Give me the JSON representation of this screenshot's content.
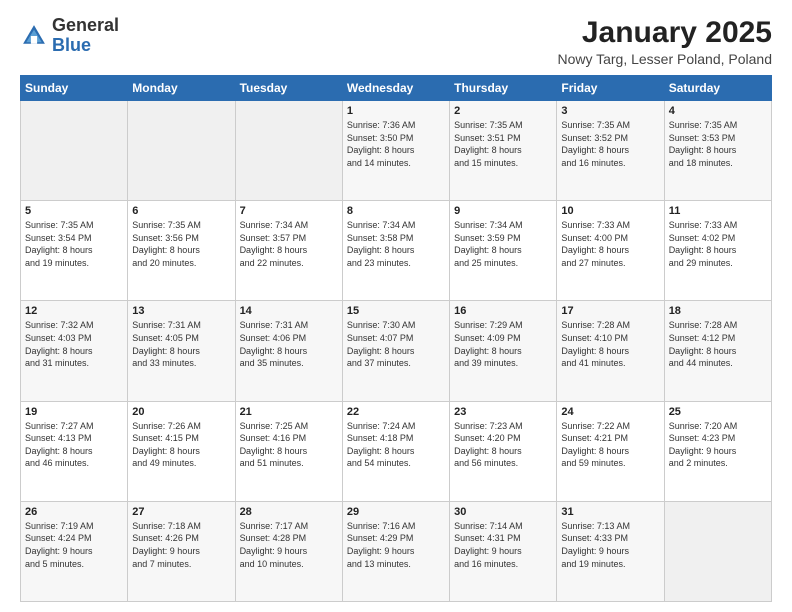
{
  "logo": {
    "general": "General",
    "blue": "Blue"
  },
  "header": {
    "title": "January 2025",
    "location": "Nowy Targ, Lesser Poland, Poland"
  },
  "weekdays": [
    "Sunday",
    "Monday",
    "Tuesday",
    "Wednesday",
    "Thursday",
    "Friday",
    "Saturday"
  ],
  "weeks": [
    [
      {
        "day": "",
        "info": ""
      },
      {
        "day": "",
        "info": ""
      },
      {
        "day": "",
        "info": ""
      },
      {
        "day": "1",
        "info": "Sunrise: 7:36 AM\nSunset: 3:50 PM\nDaylight: 8 hours\nand 14 minutes."
      },
      {
        "day": "2",
        "info": "Sunrise: 7:35 AM\nSunset: 3:51 PM\nDaylight: 8 hours\nand 15 minutes."
      },
      {
        "day": "3",
        "info": "Sunrise: 7:35 AM\nSunset: 3:52 PM\nDaylight: 8 hours\nand 16 minutes."
      },
      {
        "day": "4",
        "info": "Sunrise: 7:35 AM\nSunset: 3:53 PM\nDaylight: 8 hours\nand 18 minutes."
      }
    ],
    [
      {
        "day": "5",
        "info": "Sunrise: 7:35 AM\nSunset: 3:54 PM\nDaylight: 8 hours\nand 19 minutes."
      },
      {
        "day": "6",
        "info": "Sunrise: 7:35 AM\nSunset: 3:56 PM\nDaylight: 8 hours\nand 20 minutes."
      },
      {
        "day": "7",
        "info": "Sunrise: 7:34 AM\nSunset: 3:57 PM\nDaylight: 8 hours\nand 22 minutes."
      },
      {
        "day": "8",
        "info": "Sunrise: 7:34 AM\nSunset: 3:58 PM\nDaylight: 8 hours\nand 23 minutes."
      },
      {
        "day": "9",
        "info": "Sunrise: 7:34 AM\nSunset: 3:59 PM\nDaylight: 8 hours\nand 25 minutes."
      },
      {
        "day": "10",
        "info": "Sunrise: 7:33 AM\nSunset: 4:00 PM\nDaylight: 8 hours\nand 27 minutes."
      },
      {
        "day": "11",
        "info": "Sunrise: 7:33 AM\nSunset: 4:02 PM\nDaylight: 8 hours\nand 29 minutes."
      }
    ],
    [
      {
        "day": "12",
        "info": "Sunrise: 7:32 AM\nSunset: 4:03 PM\nDaylight: 8 hours\nand 31 minutes."
      },
      {
        "day": "13",
        "info": "Sunrise: 7:31 AM\nSunset: 4:05 PM\nDaylight: 8 hours\nand 33 minutes."
      },
      {
        "day": "14",
        "info": "Sunrise: 7:31 AM\nSunset: 4:06 PM\nDaylight: 8 hours\nand 35 minutes."
      },
      {
        "day": "15",
        "info": "Sunrise: 7:30 AM\nSunset: 4:07 PM\nDaylight: 8 hours\nand 37 minutes."
      },
      {
        "day": "16",
        "info": "Sunrise: 7:29 AM\nSunset: 4:09 PM\nDaylight: 8 hours\nand 39 minutes."
      },
      {
        "day": "17",
        "info": "Sunrise: 7:28 AM\nSunset: 4:10 PM\nDaylight: 8 hours\nand 41 minutes."
      },
      {
        "day": "18",
        "info": "Sunrise: 7:28 AM\nSunset: 4:12 PM\nDaylight: 8 hours\nand 44 minutes."
      }
    ],
    [
      {
        "day": "19",
        "info": "Sunrise: 7:27 AM\nSunset: 4:13 PM\nDaylight: 8 hours\nand 46 minutes."
      },
      {
        "day": "20",
        "info": "Sunrise: 7:26 AM\nSunset: 4:15 PM\nDaylight: 8 hours\nand 49 minutes."
      },
      {
        "day": "21",
        "info": "Sunrise: 7:25 AM\nSunset: 4:16 PM\nDaylight: 8 hours\nand 51 minutes."
      },
      {
        "day": "22",
        "info": "Sunrise: 7:24 AM\nSunset: 4:18 PM\nDaylight: 8 hours\nand 54 minutes."
      },
      {
        "day": "23",
        "info": "Sunrise: 7:23 AM\nSunset: 4:20 PM\nDaylight: 8 hours\nand 56 minutes."
      },
      {
        "day": "24",
        "info": "Sunrise: 7:22 AM\nSunset: 4:21 PM\nDaylight: 8 hours\nand 59 minutes."
      },
      {
        "day": "25",
        "info": "Sunrise: 7:20 AM\nSunset: 4:23 PM\nDaylight: 9 hours\nand 2 minutes."
      }
    ],
    [
      {
        "day": "26",
        "info": "Sunrise: 7:19 AM\nSunset: 4:24 PM\nDaylight: 9 hours\nand 5 minutes."
      },
      {
        "day": "27",
        "info": "Sunrise: 7:18 AM\nSunset: 4:26 PM\nDaylight: 9 hours\nand 7 minutes."
      },
      {
        "day": "28",
        "info": "Sunrise: 7:17 AM\nSunset: 4:28 PM\nDaylight: 9 hours\nand 10 minutes."
      },
      {
        "day": "29",
        "info": "Sunrise: 7:16 AM\nSunset: 4:29 PM\nDaylight: 9 hours\nand 13 minutes."
      },
      {
        "day": "30",
        "info": "Sunrise: 7:14 AM\nSunset: 4:31 PM\nDaylight: 9 hours\nand 16 minutes."
      },
      {
        "day": "31",
        "info": "Sunrise: 7:13 AM\nSunset: 4:33 PM\nDaylight: 9 hours\nand 19 minutes."
      },
      {
        "day": "",
        "info": ""
      }
    ]
  ]
}
